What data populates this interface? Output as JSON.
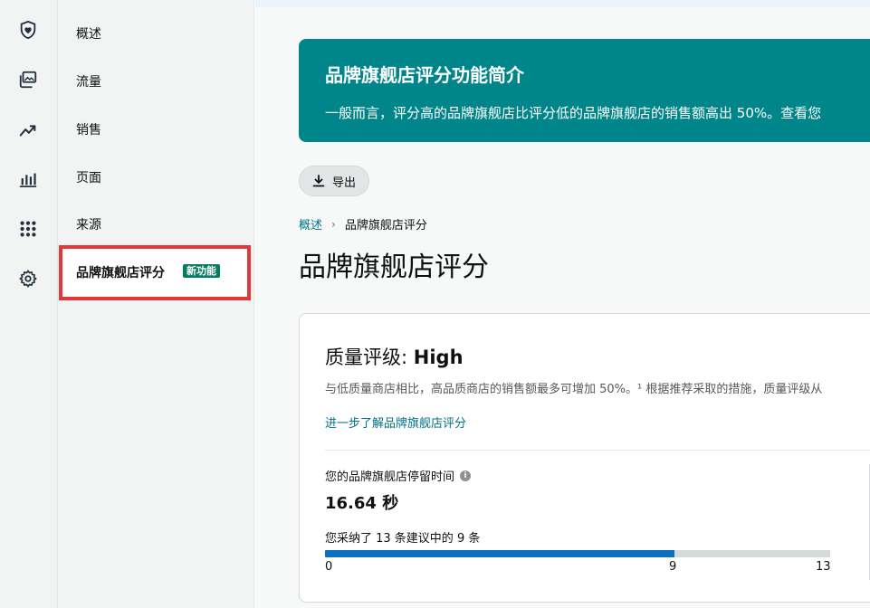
{
  "rail": {
    "icons": [
      "shield-heart-icon",
      "gallery-icon",
      "trend-icon",
      "bar-chart-icon",
      "grid-icon",
      "gear-icon"
    ]
  },
  "subnav": {
    "items": [
      "概述",
      "流量",
      "销售",
      "页面",
      "来源"
    ],
    "active_label": "品牌旗舰店评分",
    "active_badge": "新功能"
  },
  "banner": {
    "title": "品牌旗舰店评分功能简介",
    "text": "一般而言，评分高的品牌旗舰店比评分低的品牌旗舰店的销售额高出 50%。查看您"
  },
  "toolbar": {
    "export_label": "导出"
  },
  "breadcrumb": {
    "parent": "概述",
    "separator": "›",
    "current": "品牌旗舰店评分"
  },
  "page": {
    "title": "品牌旗舰店评分"
  },
  "card": {
    "title_prefix": "质量评级: ",
    "grade": "High",
    "description": "与低质量商店相比，高品质商店的销售额最多可增加 50%。¹ 根据推荐采取的措施，质量评级从",
    "learn_more": "进一步了解品牌旗舰店评分",
    "dwell_label": "您的品牌旗舰店停留时间",
    "info": "i",
    "dwell_value": "16.64 秒",
    "adopt_text": "您采纳了 13 条建议中的 9 条",
    "progress": {
      "adopted": 9,
      "total": 13,
      "min_label": "0",
      "value_label": "9",
      "max_label": "13"
    }
  },
  "colors": {
    "banner": "#00868a",
    "badge": "#067d62",
    "link": "#007185",
    "progress": "#0b6fbd",
    "highlight_border": "#e3373a"
  }
}
